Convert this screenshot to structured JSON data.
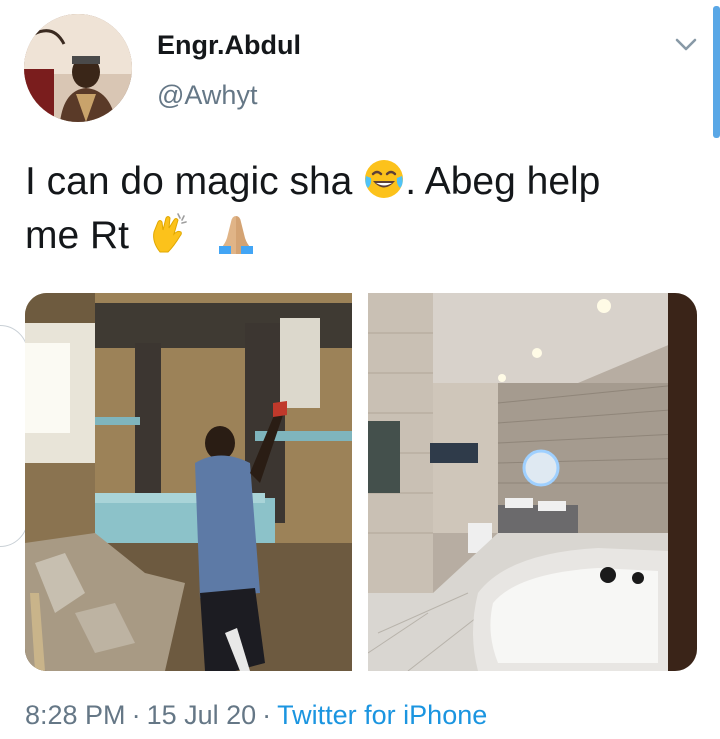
{
  "author": {
    "display_name": "Engr.Abdul",
    "handle": "@Awhyt",
    "avatar": "profile-photo"
  },
  "tweet": {
    "text_part1": "I can do magic sha",
    "text_part2": ". Abeg help",
    "text_part3": "me Rt",
    "emojis": [
      "face-with-tears-of-joy-emoji",
      "clapping-hands-emoji",
      "folded-hands-emoji"
    ]
  },
  "media": [
    {
      "name": "bathroom-before-photo",
      "description": "construction"
    },
    {
      "name": "bathroom-after-photo",
      "description": "finished"
    }
  ],
  "meta": {
    "time": "8:28 PM",
    "separator": "·",
    "date": "15 Jul 20",
    "source": "Twitter for iPhone"
  },
  "colors": {
    "text": "#14171a",
    "secondary": "#657786",
    "link": "#1b95e0",
    "scrollbar": "#59a7e6"
  }
}
